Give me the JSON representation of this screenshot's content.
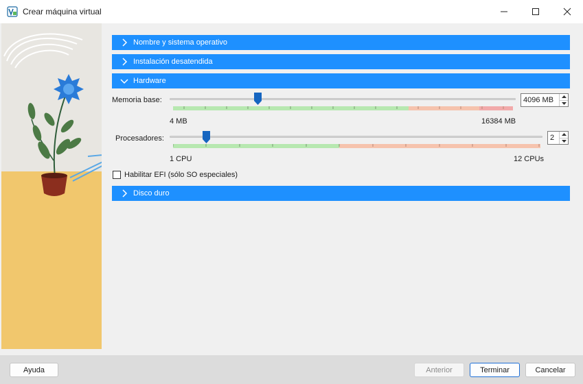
{
  "window": {
    "title": "Crear máquina virtual",
    "icons": {
      "app": "virtualbox-icon",
      "minimize": "minimize-icon",
      "maximize": "maximize-icon",
      "close": "close-icon"
    }
  },
  "sections": [
    {
      "label": "Nombre y sistema operativo",
      "expanded": false
    },
    {
      "label": "Instalación desatendida",
      "expanded": false
    },
    {
      "label": "Hardware",
      "expanded": true
    },
    {
      "label": "Disco duro",
      "expanded": false
    }
  ],
  "hardware": {
    "memory": {
      "label": "Memoria base:",
      "value": "4096 MB",
      "min_label": "4 MB",
      "max_label": "16384 MB",
      "fraction": 0.25
    },
    "cpus": {
      "label": "Procesadores:",
      "value": "2",
      "min_label": "1 CPU",
      "max_label": "12 CPUs",
      "fraction": 0.09
    },
    "efi": {
      "label": "Habilitar EFI (sólo SO especiales)",
      "checked": false
    }
  },
  "buttons": {
    "help": "Ayuda",
    "back": "Anterior",
    "finish": "Terminar",
    "cancel": "Cancelar"
  },
  "colors": {
    "accent": "#1e90ff",
    "zone_green": "#b7e8b0",
    "zone_orange": "#f6c3ad",
    "zone_red": "#f2aaaa",
    "thumb": "#1565c0"
  }
}
